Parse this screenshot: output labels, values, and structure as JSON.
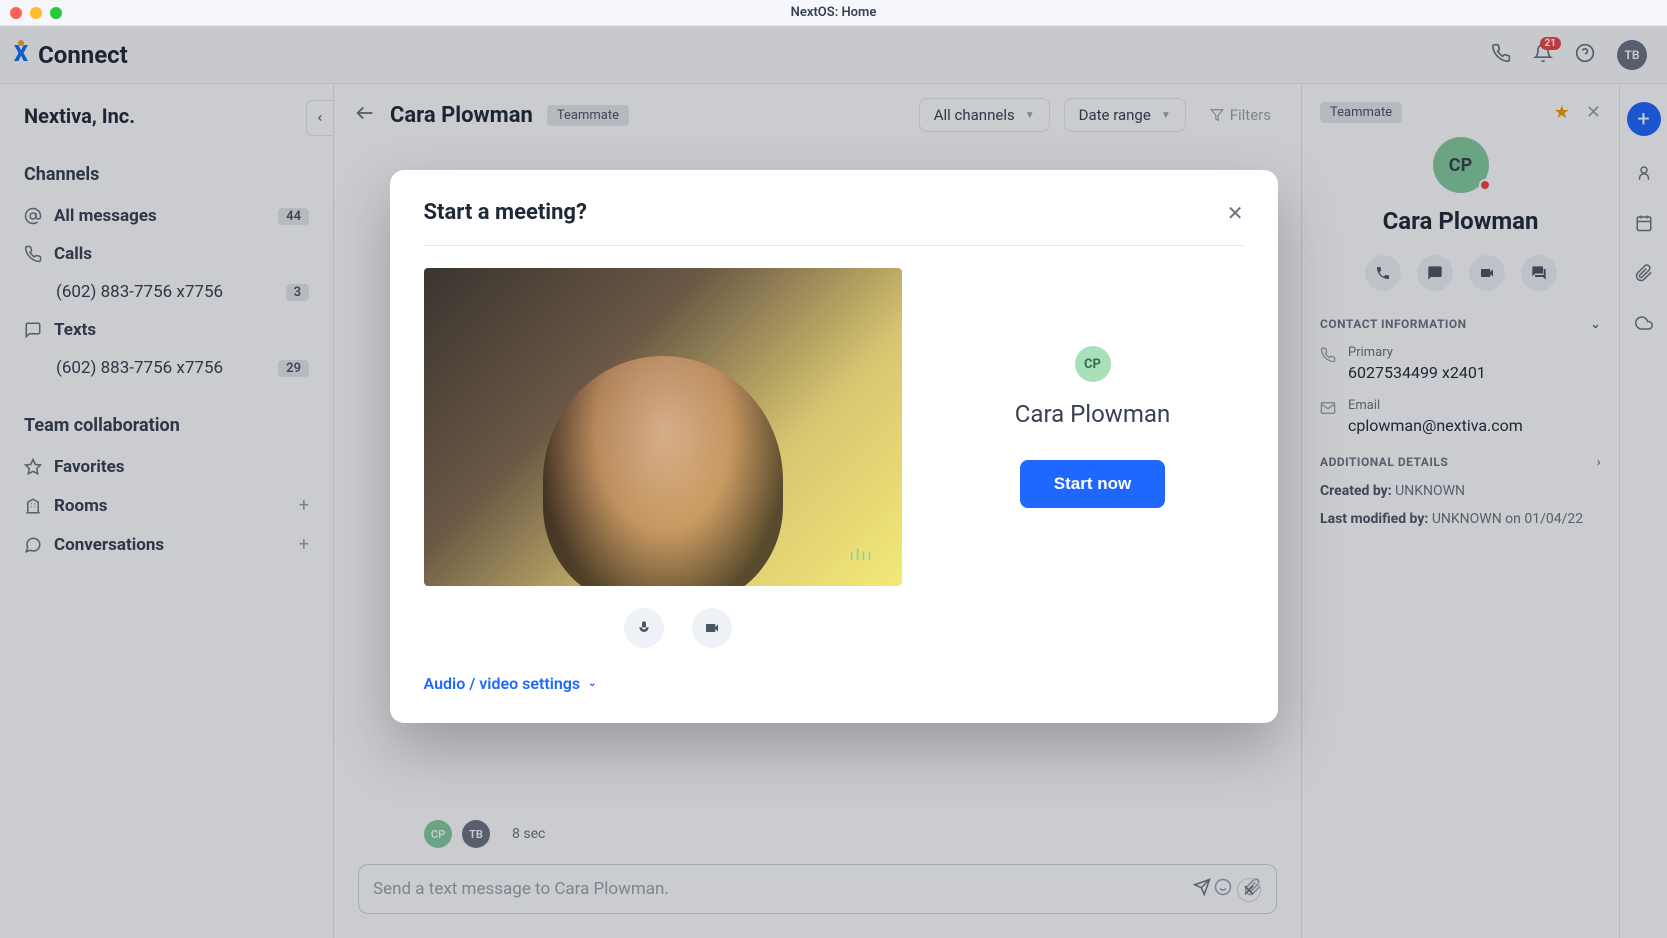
{
  "window": {
    "title": "NextOS: Home"
  },
  "header": {
    "brand": "Connect",
    "bell_count": "21",
    "avatar_initials": "TB"
  },
  "sidebar": {
    "org": "Nextiva, Inc.",
    "section_channels": "Channels",
    "all_messages": "All messages",
    "all_messages_badge": "44",
    "calls": "Calls",
    "calls_number": "(602) 883-7756 x7756",
    "calls_badge": "3",
    "texts": "Texts",
    "texts_number": "(602) 883-7756 x7756",
    "texts_badge": "29",
    "section_team": "Team collaboration",
    "favorites": "Favorites",
    "rooms": "Rooms",
    "conversations": "Conversations"
  },
  "conversation": {
    "name": "Cara Plowman",
    "tag": "Teammate",
    "filter_channels": "All channels",
    "filter_date": "Date range",
    "filter_label": "Filters",
    "call_duration": "8 sec",
    "input_placeholder": "Send a text message to Cara Plowman.",
    "cp_initials": "CP",
    "tb_initials": "TB"
  },
  "rightpanel": {
    "tag": "Teammate",
    "avatar_initials": "CP",
    "name": "Cara Plowman",
    "section_contact": "CONTACT INFORMATION",
    "primary_label": "Primary",
    "primary_val": "6027534499 x2401",
    "email_label": "Email",
    "email_val": "cplowman@nextiva.com",
    "section_additional": "ADDITIONAL DETAILS",
    "created_label": "Created by:",
    "created_val": "UNKNOWN",
    "modified_label": "Last modified by:",
    "modified_val": "UNKNOWN on 01/04/22"
  },
  "modal": {
    "title": "Start a meeting?",
    "avatar_initials": "CP",
    "name": "Cara Plowman",
    "start_btn": "Start now",
    "av_settings": "Audio / video settings"
  }
}
